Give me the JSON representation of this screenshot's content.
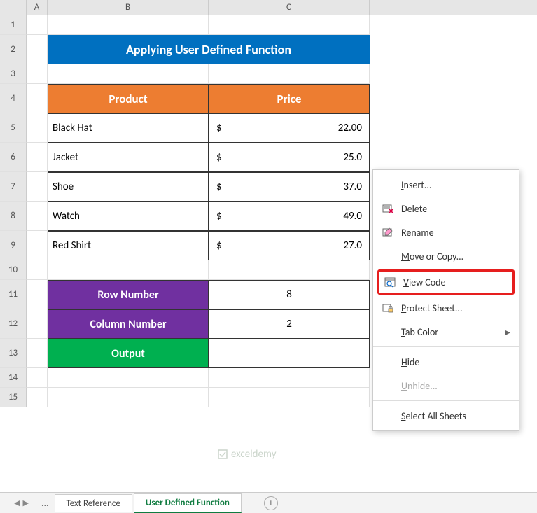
{
  "columns": [
    "A",
    "B",
    "C"
  ],
  "rows": [
    "1",
    "2",
    "3",
    "4",
    "5",
    "6",
    "7",
    "8",
    "9",
    "10",
    "11",
    "12",
    "13",
    "14",
    "15"
  ],
  "title": "Applying User Defined Function",
  "table": {
    "headers": {
      "product": "Product",
      "price": "Price"
    },
    "rows": [
      {
        "product": "Black Hat",
        "price": "22.00"
      },
      {
        "product": "Jacket",
        "price": "25.0"
      },
      {
        "product": "Shoe",
        "price": "37.0"
      },
      {
        "product": "Watch",
        "price": "49.0"
      },
      {
        "product": "Red Shirt",
        "price": "27.0"
      }
    ],
    "currency": "$"
  },
  "inputs": {
    "row_number_label": "Row Number",
    "row_number_value": "8",
    "column_number_label": "Column Number",
    "column_number_value": "2",
    "output_label": "Output",
    "output_value": ""
  },
  "tabs": {
    "inactive": "Text Reference",
    "active": "User Defined Function"
  },
  "context_menu": {
    "insert": "Insert...",
    "delete": "Delete",
    "rename": "Rename",
    "move_or_copy": "Move or Copy...",
    "view_code": "View Code",
    "protect_sheet": "Protect Sheet...",
    "tab_color": "Tab Color",
    "hide": "Hide",
    "unhide": "Unhide...",
    "select_all": "Select All Sheets"
  },
  "watermark": "exceldemy"
}
